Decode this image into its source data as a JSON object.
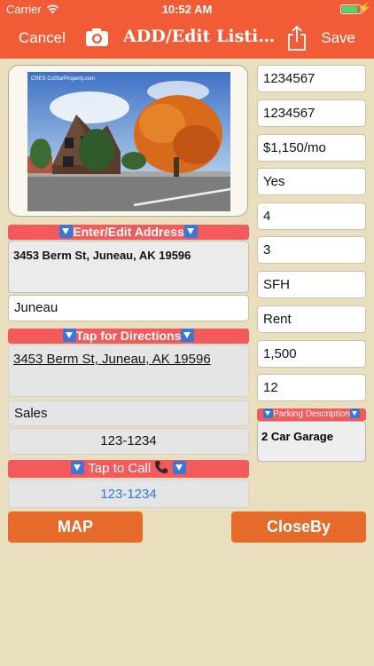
{
  "status_bar": {
    "carrier": "Carrier",
    "time": "10:52 AM",
    "battery_level": 0.85
  },
  "nav": {
    "cancel": "Cancel",
    "title": "ADD/Edit Listing",
    "save": "Save"
  },
  "photo": {
    "watermark": "CRES CoStarProperty.com"
  },
  "address": {
    "banner": "Enter/Edit Address",
    "value": "3453 Berm St, Juneau, AK 19596",
    "city": "Juneau"
  },
  "directions": {
    "banner": "Tap for Directions",
    "value": "3453 Berm St, Juneau, AK 19596"
  },
  "contact": {
    "label": "Sales",
    "phone_display": "123-1234",
    "call_banner": "Tap to Call",
    "call_number": "123-1234"
  },
  "right_fields": [
    "1234567",
    "1234567",
    "$1,150/mo",
    "Yes",
    "4",
    "3",
    "SFH",
    "Rent",
    "1,500",
    "12"
  ],
  "parking": {
    "banner": "Parking Description",
    "value": "2 Car Garage"
  },
  "buttons": {
    "map": "MAP",
    "closeby": "CloseBy"
  },
  "colors": {
    "accent": "#f15b35",
    "banner": "#f45a5c",
    "button": "#e66b2b",
    "background": "#e9dfbf",
    "link": "#2a7bd9"
  }
}
